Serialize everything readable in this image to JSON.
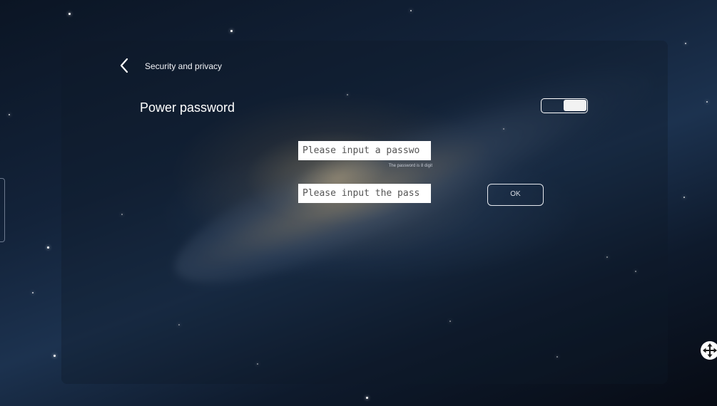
{
  "header": {
    "back_icon": "chevron-left-icon",
    "title": "Security and privacy"
  },
  "setting": {
    "label": "Power password",
    "toggle_on": true
  },
  "form": {
    "password_placeholder": "Please input a passwo",
    "hint": "The password is 8 digit",
    "confirm_placeholder": "Please input the pass",
    "ok_label": "OK"
  },
  "floating": {
    "move_icon": "move-arrows-icon"
  },
  "colors": {
    "text": "#ffffff",
    "input_bg": "#ffffff",
    "panel": "#0f1928"
  }
}
